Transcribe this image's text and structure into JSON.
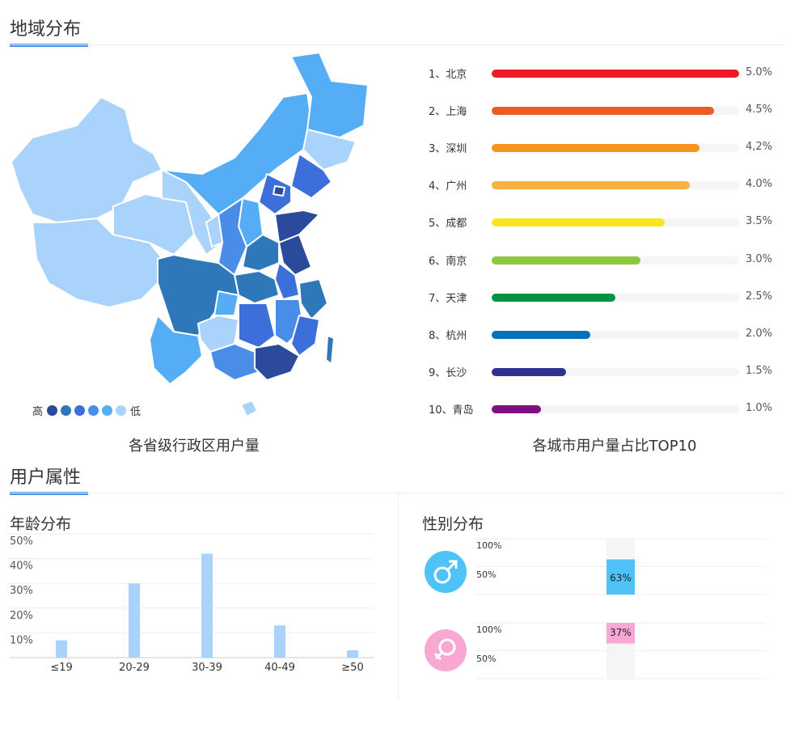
{
  "section1": {
    "title": "地域分布"
  },
  "section2": {
    "title": "用户属性"
  },
  "map": {
    "caption": "各省级行政区用户量",
    "legend": {
      "high": "高",
      "low": "低",
      "colors": [
        "#2b4a9c",
        "#2e77b8",
        "#3c6fd9",
        "#4a8de8",
        "#55aef5",
        "#a9d3fb"
      ]
    }
  },
  "ranking": {
    "caption": "各城市用户量占比TOP10",
    "items": [
      {
        "label": "1、北京",
        "value_text": "5.0%",
        "value": 5.0,
        "color": "#ed1c24"
      },
      {
        "label": "2、上海",
        "value_text": "4.5%",
        "value": 4.5,
        "color": "#ee5a24"
      },
      {
        "label": "3、深圳",
        "value_text": "4,2%",
        "value": 4.2,
        "color": "#f7941d"
      },
      {
        "label": "4、广州",
        "value_text": "4.0%",
        "value": 4.0,
        "color": "#fbb040"
      },
      {
        "label": "5、成都",
        "value_text": "3.5%",
        "value": 3.5,
        "color": "#f9e71e"
      },
      {
        "label": "6、南京",
        "value_text": "3.0%",
        "value": 3.0,
        "color": "#8dc63f"
      },
      {
        "label": "7、天津",
        "value_text": "2.5%",
        "value": 2.5,
        "color": "#009245"
      },
      {
        "label": "8、杭州",
        "value_text": "2.0%",
        "value": 2.0,
        "color": "#0071bc"
      },
      {
        "label": "9、长沙",
        "value_text": "1.5%",
        "value": 1.5,
        "color": "#2e3192"
      },
      {
        "label": "10、青岛",
        "value_text": "1.0%",
        "value": 1.0,
        "color": "#7f1084"
      }
    ]
  },
  "age": {
    "title": "年龄分布",
    "y_ticks": [
      "50%",
      "40%",
      "30%",
      "20%",
      "10%"
    ]
  },
  "gender": {
    "title": "性别分布",
    "male": {
      "pct_text": "63%",
      "pct": 63,
      "ticks": [
        "100%",
        "50%"
      ],
      "color": "#4fc3f7",
      "icon": "male-symbol-icon"
    },
    "female": {
      "pct_text": "37%",
      "pct": 37,
      "ticks": [
        "100%",
        "50%"
      ],
      "color": "#f9a8d4",
      "icon": "female-symbol-icon"
    }
  },
  "chart_data": [
    {
      "type": "bar",
      "title": "各城市用户量占比TOP10",
      "categories": [
        "北京",
        "上海",
        "深圳",
        "广州",
        "成都",
        "南京",
        "天津",
        "杭州",
        "长沙",
        "青岛"
      ],
      "values": [
        5.0,
        4.5,
        4.2,
        4.0,
        3.5,
        3.0,
        2.5,
        2.0,
        1.5,
        1.0
      ],
      "orientation": "horizontal"
    },
    {
      "type": "bar",
      "title": "年龄分布",
      "categories": [
        "≤19",
        "20-29",
        "30-39",
        "40-49",
        "≥50"
      ],
      "values": [
        7,
        30,
        42,
        13,
        3
      ],
      "ylim": [
        0,
        50
      ],
      "color": "#a9d3fb"
    },
    {
      "type": "bar",
      "title": "性别分布",
      "categories": [
        "男",
        "女"
      ],
      "values": [
        63,
        37
      ],
      "ylim": [
        0,
        100
      ]
    }
  ]
}
